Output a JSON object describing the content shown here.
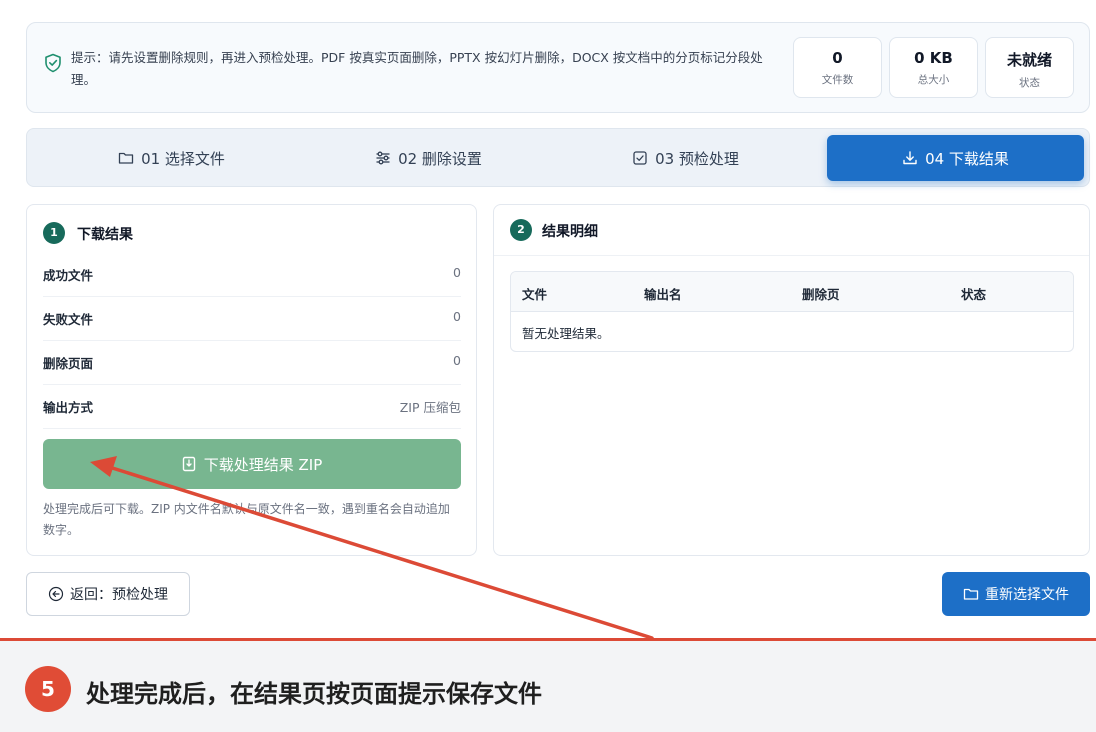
{
  "info": {
    "tip": "提示：请先设置删除规则，再进入预检处理。PDF 按真实页面删除，PPTX 按幻灯片删除，DOCX 按文档中的分页标记分段处理。",
    "stats": [
      {
        "value": "0",
        "label": "文件数"
      },
      {
        "value": "0 KB",
        "label": "总大小"
      },
      {
        "value": "未就绪",
        "label": "状态"
      }
    ]
  },
  "steps": [
    {
      "label": "01 选择文件",
      "icon": "folder-icon"
    },
    {
      "label": "02 删除设置",
      "icon": "sliders-icon"
    },
    {
      "label": "03 预检处理",
      "icon": "checkbox-icon"
    },
    {
      "label": "04 下载结果",
      "icon": "download-icon",
      "active": true
    }
  ],
  "download_panel": {
    "badge": "1",
    "title": "下载结果",
    "rows": [
      {
        "label": "成功文件",
        "value": "0"
      },
      {
        "label": "失败文件",
        "value": "0"
      },
      {
        "label": "删除页面",
        "value": "0"
      },
      {
        "label": "输出方式",
        "value": "ZIP 压缩包"
      }
    ],
    "button_label": "下载处理结果 ZIP",
    "hint": "处理完成后可下载。ZIP 内文件名默认与原文件名一致，遇到重名会自动追加数字。"
  },
  "detail_panel": {
    "badge": "2",
    "title": "结果明细",
    "columns": [
      "文件",
      "输出名",
      "删除页",
      "状态"
    ],
    "empty_text": "暂无处理结果。"
  },
  "footer": {
    "back_label": "返回：预检处理",
    "reselect_label": "重新选择文件"
  },
  "caption": {
    "number": "5",
    "text": "处理完成后，在结果页按页面提示保存文件"
  },
  "colors": {
    "primary": "#1d6fc7",
    "download_button": "#78b690",
    "badge": "#176a5b",
    "annotation": "#dc4a36"
  }
}
